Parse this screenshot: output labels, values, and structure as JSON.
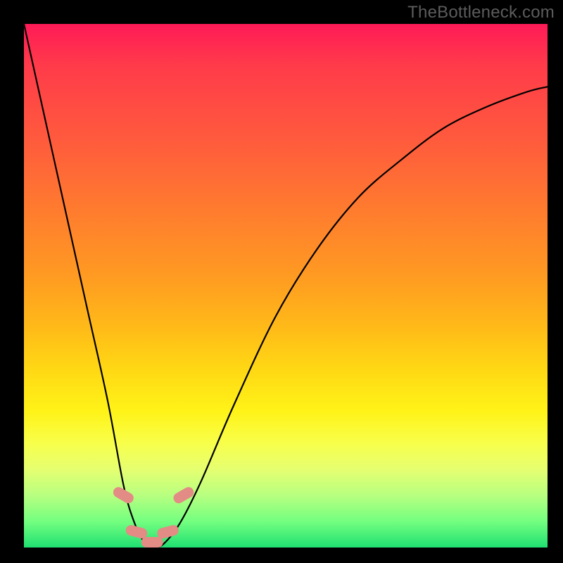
{
  "watermark": "TheBottleneck.com",
  "colors": {
    "frame": "#000000",
    "gradient_stops": [
      "#ff1a57",
      "#ff5a3d",
      "#ff9a22",
      "#ffd814",
      "#fff318",
      "#b8ff80",
      "#1fe072"
    ],
    "curve": "#000000",
    "markers": "#e38b85"
  },
  "chart_data": {
    "type": "line",
    "title": "",
    "xlabel": "",
    "ylabel": "",
    "xlim": [
      0,
      100
    ],
    "ylim": [
      0,
      100
    ],
    "grid": false,
    "legend": false,
    "x": [
      0,
      4,
      8,
      12,
      16,
      19,
      21,
      23,
      25,
      27,
      30,
      34,
      40,
      48,
      56,
      64,
      72,
      80,
      88,
      96,
      100
    ],
    "y": [
      100,
      82,
      64,
      46,
      28,
      12,
      5,
      1,
      0,
      1,
      5,
      13,
      27,
      44,
      57,
      67,
      74,
      80,
      84,
      87,
      88
    ],
    "markers": {
      "x": [
        19.0,
        21.5,
        24.5,
        27.5,
        30.5
      ],
      "y": [
        10,
        3,
        1,
        3,
        10
      ]
    },
    "annotations": []
  }
}
